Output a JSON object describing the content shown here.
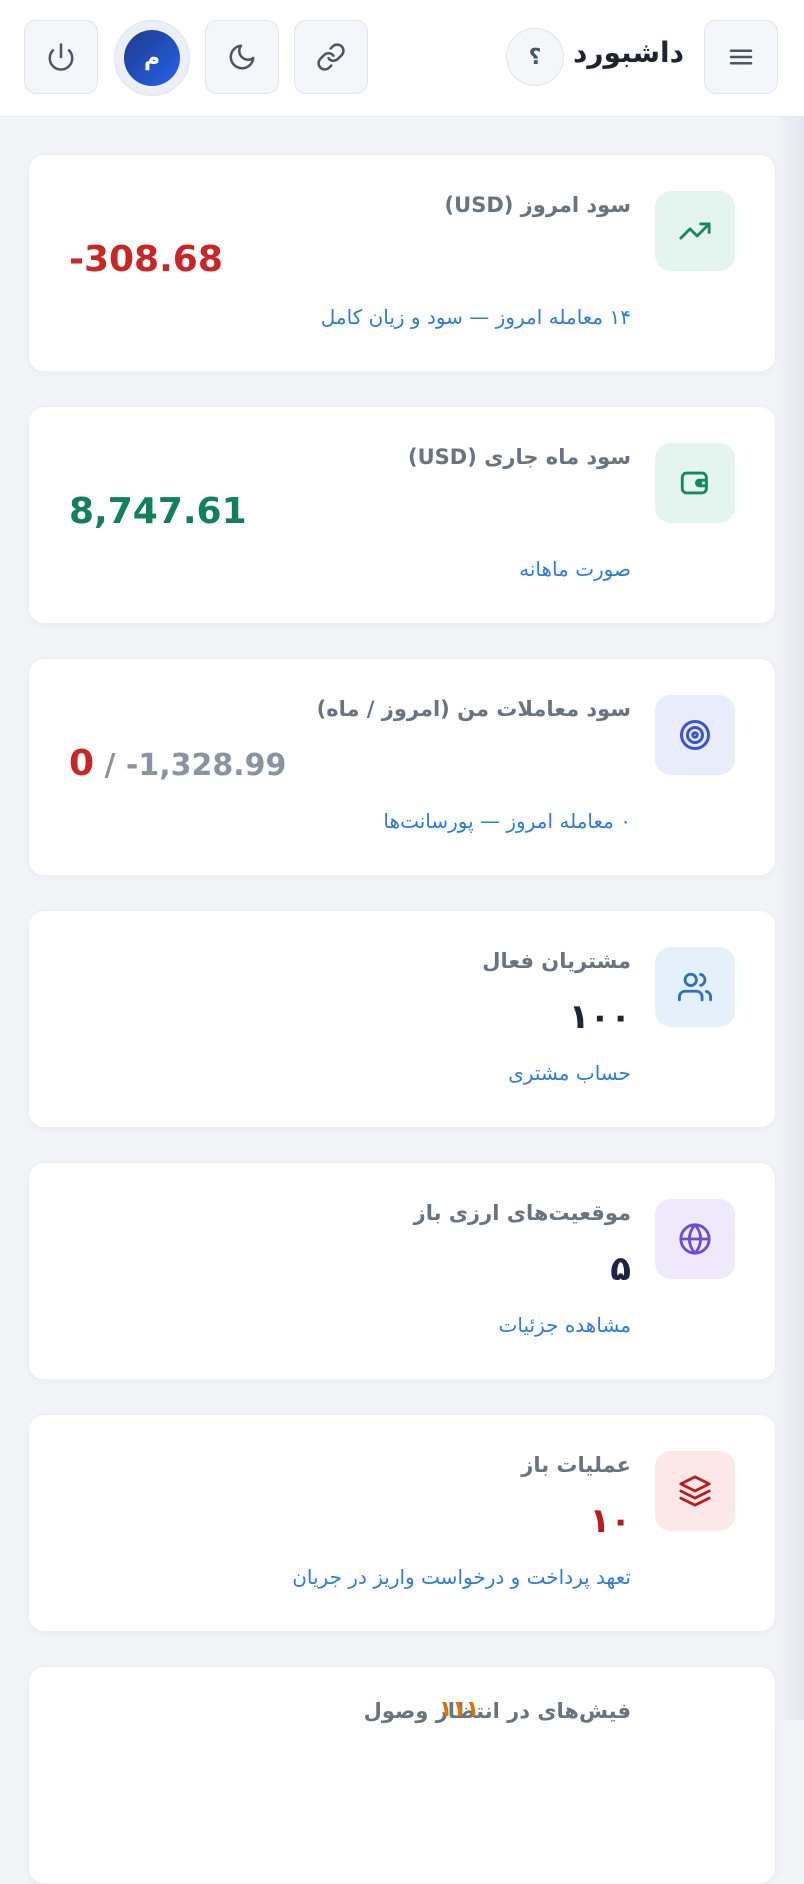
{
  "header": {
    "title": "داشبورد",
    "help_label": "؟",
    "avatar_initial": "م",
    "icons": {
      "menu": "menu-icon",
      "link": "link-icon",
      "theme": "moon-icon",
      "power": "power-icon"
    }
  },
  "cards": [
    {
      "title": "سود امروز (USD)",
      "value": "-308.68",
      "link": "۱۴ معامله امروز — سود و زیان کامل",
      "icon": "trending-up-icon",
      "icon_color": "#16875f",
      "icon_bg": "#e3f5ee",
      "value_color": "#c62828"
    },
    {
      "title": "سود ماه جاری (USD)",
      "value": "8,747.61",
      "link": "صورت ماهانه",
      "icon": "wallet-icon",
      "icon_color": "#16875f",
      "icon_bg": "#e3f5ee",
      "value_color": "#12805c"
    },
    {
      "title": "سود معاملات من (امروز / ماه)",
      "value_today": "0",
      "value_separator": " / ",
      "value_month": "-1,328.99",
      "link": "۰ معامله امروز — پورسانت‌ها",
      "icon": "target-icon",
      "icon_color": "#3b52d4",
      "icon_bg": "#e8ecfb"
    },
    {
      "title": "مشتریان فعال",
      "value": "۱۰۰",
      "link": "حساب مشتری",
      "icon": "users-icon",
      "icon_color": "#2f6fb8",
      "icon_bg": "#e4f1fb"
    },
    {
      "title": "موقعیت‌های ارزی باز",
      "value": "۵",
      "link": "مشاهده جزئیات",
      "icon": "globe-icon",
      "icon_color": "#6d4ad8",
      "icon_bg": "#eeeafc"
    },
    {
      "title": "عملیات باز",
      "value": "۱۰",
      "link": "تعهد پرداخت و درخواست واریز در جریان",
      "icon": "layers-icon",
      "icon_color": "#b91c1c",
      "icon_bg": "#fce8e8",
      "value_color": "#b91c1c"
    },
    {
      "title": "فیش‌های در انتظار وصول",
      "badge": "۱۱۱"
    }
  ]
}
